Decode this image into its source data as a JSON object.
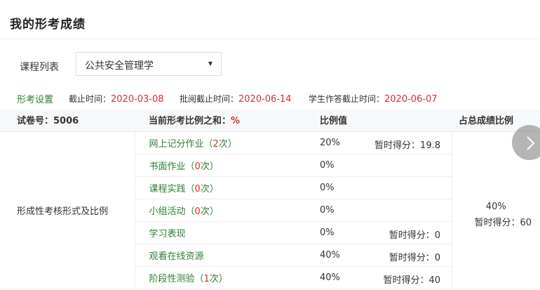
{
  "page": {
    "title": "我的形考成绩"
  },
  "course": {
    "label": "课程列表",
    "selected": "公共安全管理学"
  },
  "settings": {
    "title": "形考设置",
    "deadline_label": "截止时间：",
    "deadline": "2020-03-08",
    "review_label": "批阅截止时间：",
    "review_deadline": "2020-06-14",
    "student_label": "学生作答截止时间：",
    "student_deadline": "2020-06-07"
  },
  "table": {
    "headers": {
      "paper": "试卷号：5006",
      "ratio_sum": "当前形考比例之和：",
      "ratio_sum_value": "%",
      "ratio": "比例值",
      "total": "占总成绩比例"
    },
    "form_label": "形成性考核形式及比例",
    "rows": [
      {
        "name": "网上记分作业",
        "open": "（",
        "count": "2",
        "unit": "次）",
        "ratio": "20%",
        "temp": "暂时得分：19.8"
      },
      {
        "name": "书面作业",
        "open": "（",
        "count": "0",
        "unit": "次）",
        "ratio": "0%",
        "temp": ""
      },
      {
        "name": "课程实践",
        "open": "（",
        "count": "0",
        "unit": "次）",
        "ratio": "0%",
        "temp": ""
      },
      {
        "name": "小组活动",
        "open": "（",
        "count": "0",
        "unit": "次）",
        "ratio": "0%",
        "temp": ""
      },
      {
        "name": "学习表现",
        "open": "",
        "count": "",
        "unit": "",
        "ratio": "0%",
        "temp": "暂时得分：0"
      },
      {
        "name": "观看在线资源",
        "open": "",
        "count": "",
        "unit": "",
        "ratio": "40%",
        "temp": "暂时得分：0"
      },
      {
        "name": "阶段性测验",
        "open": "（",
        "count": "1",
        "unit": "次）",
        "ratio": "40%",
        "temp": "暂时得分：40"
      }
    ],
    "total_ratio": "40%",
    "total_temp": "暂时得分：60"
  },
  "icons": {
    "next": "chevron-right-icon",
    "caret": "caret-down-icon"
  },
  "colors": {
    "green": "#2e7d32",
    "red": "#d32f2f"
  }
}
